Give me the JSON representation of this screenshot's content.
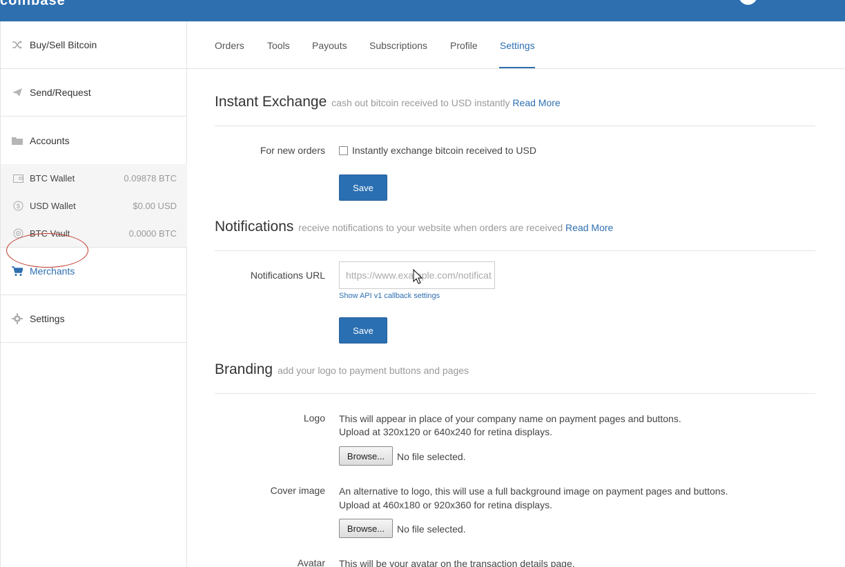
{
  "topbar": {
    "logo_fragment": "coinbase"
  },
  "sidebar": {
    "items": [
      {
        "label": "Buy/Sell Bitcoin",
        "icon": "shuffle-icon"
      },
      {
        "label": "Send/Request",
        "icon": "paper-plane-icon"
      },
      {
        "label": "Accounts",
        "icon": "folder-icon"
      },
      {
        "label": "Merchants",
        "icon": "cart-icon"
      },
      {
        "label": "Settings",
        "icon": "gear-icon"
      }
    ],
    "accounts": [
      {
        "label": "BTC Wallet",
        "amount": "0.09878 BTC",
        "icon": "wallet-icon"
      },
      {
        "label": "USD Wallet",
        "amount": "$0.00 USD",
        "icon": "dollar-coin-icon"
      },
      {
        "label": "BTC Vault",
        "amount": "0.0000 BTC",
        "icon": "vault-icon"
      }
    ]
  },
  "tabs": [
    "Orders",
    "Tools",
    "Payouts",
    "Subscriptions",
    "Profile",
    "Settings"
  ],
  "instant_exchange": {
    "title": "Instant Exchange",
    "subtitle": "cash out bitcoin received to USD instantly",
    "read_more": "Read More",
    "field_label": "For new orders",
    "checkbox_label": "Instantly exchange bitcoin received to USD",
    "save": "Save"
  },
  "notifications": {
    "title": "Notifications",
    "subtitle": "receive notifications to your website when orders are received",
    "read_more": "Read More",
    "field_label": "Notifications URL",
    "placeholder": "https://www.example.com/notificat",
    "api_link": "Show API v1 callback settings",
    "save": "Save"
  },
  "branding": {
    "title": "Branding",
    "subtitle": "add your logo to payment buttons and pages",
    "logo_label": "Logo",
    "logo_desc_1": "This will appear in place of your company name on payment pages and buttons.",
    "logo_desc_2": "Upload at 320x120 or 640x240 for retina displays.",
    "cover_label": "Cover image",
    "cover_desc_1": "An alternative to logo, this will use a full background image on payment pages and buttons.",
    "cover_desc_2": "Upload at 460x180 or 920x360 for retina displays.",
    "browse": "Browse...",
    "no_file": "No file selected.",
    "avatar_label": "Avatar",
    "avatar_desc": "This will be your avatar on the transaction details page."
  },
  "colors": {
    "accent": "#2e6fb0",
    "topbar": "#2e6fb0"
  }
}
